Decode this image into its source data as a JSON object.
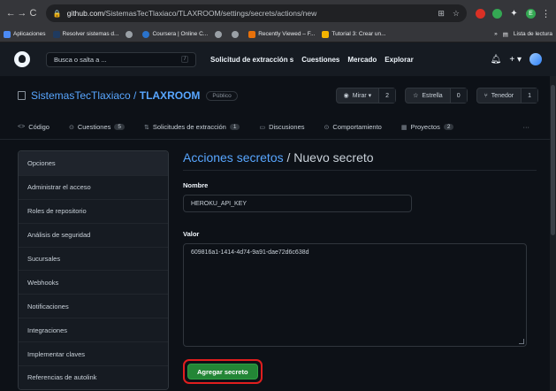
{
  "browser": {
    "url_host": "github.com",
    "url_path": "/SistemasTecTlaxiaco/TLAXROOM/settings/secrets/actions/new",
    "bookmarks": [
      {
        "label": "Aplicaciones",
        "color": "#4c8bf5"
      },
      {
        "label": "Resolver sistemas d...",
        "color": "#ffffff"
      },
      {
        "label": "",
        "color": "#9aa0a6"
      },
      {
        "label": "Coursera | Online C...",
        "color": "#2a73cc"
      },
      {
        "label": "",
        "color": "#9aa0a6"
      },
      {
        "label": "",
        "color": "#9aa0a6"
      },
      {
        "label": "Recently Viewed – F...",
        "color": "#e8710a"
      },
      {
        "label": "Tutorial 3: Crear un...",
        "color": "#f4b400"
      }
    ],
    "reading_list": "Lista de lectura",
    "more": "»"
  },
  "header": {
    "search_placeholder": "Busca o salta a ...",
    "search_key": "/",
    "nav": [
      "Solicitud de extracción s",
      "Cuestiones",
      "Mercado",
      "Explorar"
    ],
    "bell": "♫",
    "plus": "+ ▾"
  },
  "repo": {
    "owner": "SistemasTecTlaxiaco",
    "separator": " / ",
    "name": "TLAXROOM",
    "visibility": "Público",
    "watch_label": "Mirar ▾",
    "watch_count": "2",
    "star_label": "Estrella",
    "star_count": "0",
    "fork_label": "Tenedor",
    "fork_count": "1"
  },
  "tabs": [
    {
      "label": "Código",
      "icon": "<>",
      "count": ""
    },
    {
      "label": "Cuestiones",
      "icon": "⊙",
      "count": "5"
    },
    {
      "label": "Solicitudes de extracción",
      "icon": "⇅",
      "count": "1"
    },
    {
      "label": "Discusiones",
      "icon": "▭",
      "count": ""
    },
    {
      "label": "Comportamiento",
      "icon": "⊙",
      "count": ""
    },
    {
      "label": "Proyectos",
      "icon": "▦",
      "count": "2"
    }
  ],
  "tabs_more": "···",
  "sidebar": {
    "items": [
      "Opciones",
      "Administrar el acceso",
      "Roles de repositorio",
      "Análisis de seguridad",
      "Sucursales",
      "Webhooks",
      "Notificaciones",
      "Integraciones",
      "Implementar claves",
      "Referencias de autolink"
    ]
  },
  "main": {
    "heading_link": "Acciones secretos",
    "heading_sep": " / ",
    "heading_rest": "Nuevo secreto",
    "name_label": "Nombre",
    "name_value": "HEROKU_API_KEY",
    "value_label": "Valor",
    "value_value": "609816a1-1414-4d74-9a91-dae72d6c638d",
    "submit_label": "Agregar secreto"
  },
  "colors": {
    "accent_link": "#58a6ff",
    "button_green": "#238636",
    "highlight_red": "#e01e1e"
  }
}
